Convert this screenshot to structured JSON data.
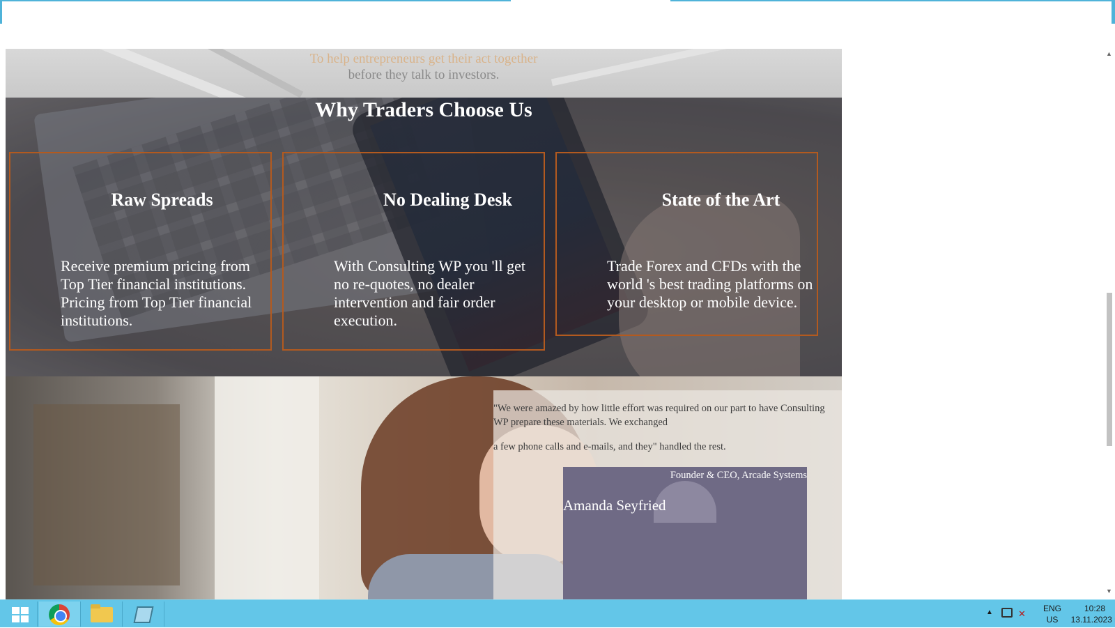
{
  "hero": {
    "line1": "To help entrepreneurs get their act together",
    "line2": "before they talk to investors."
  },
  "why": {
    "title": "Why Traders Choose Us",
    "cards": [
      {
        "title": "Raw Spreads",
        "text": "Receive premium pricing from Top Tier financial institutions. Pricing from Top Tier financial institutions."
      },
      {
        "title": "No Dealing Desk",
        "text": "With Consulting WP you 'll get no re-quotes, no dealer intervention and fair order execution."
      },
      {
        "title": "State of the Art",
        "text": "Trade Forex and CFDs with the world 's best trading platforms on your desktop or mobile device."
      }
    ]
  },
  "testimonial": {
    "quote_part1": "\"We were amazed by how little effort was required on our part to have Consulting WP prepare these materials. We exchanged",
    "quote_part2": "a few phone calls and e-mails, and they\" handled the rest.",
    "role": "Founder & CEO, Arcade Systems",
    "name": "Amanda Seyfried"
  },
  "scrollbar": {
    "up_icon": "▲",
    "down_icon": "▼"
  },
  "taskbar": {
    "apps": [
      "windows-start",
      "chrome",
      "file-explorer",
      "notepad"
    ],
    "tray": {
      "arrow": "▲",
      "volume": "✕",
      "lang_top": "ENG",
      "lang_bottom": "US",
      "time": "10:28",
      "date": "13.11.2023 г."
    }
  },
  "colors": {
    "card_border": "#b35a1f",
    "taskbar": "#63c6e8",
    "accent_line": "#4fb3d9"
  }
}
